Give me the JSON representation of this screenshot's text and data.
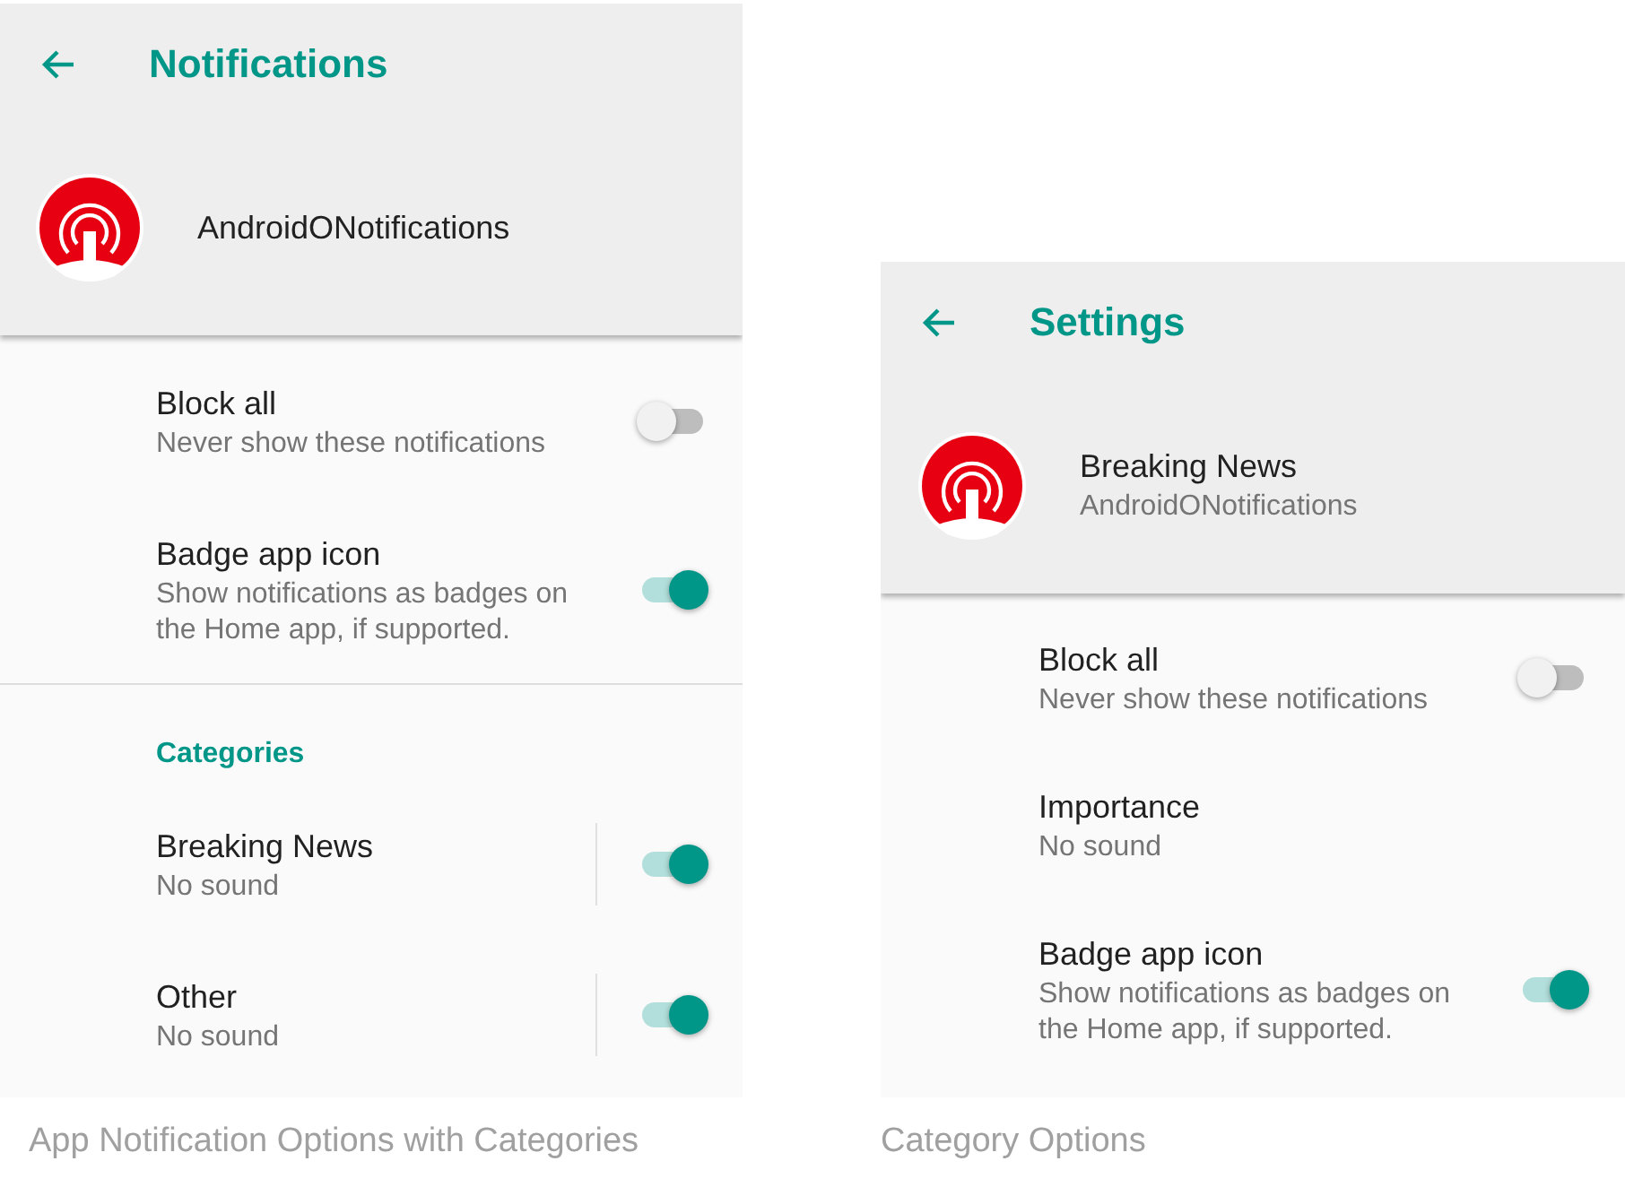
{
  "screens": [
    {
      "title": "Notifications",
      "app": {
        "name": "AndroidONotifications"
      },
      "caption": "App Notification Options with Categories",
      "items": [
        {
          "kind": "toggle",
          "title": "Block all",
          "summary": "Never show these notifications",
          "on": false,
          "divided": false
        },
        {
          "kind": "toggle",
          "title": "Badge app icon",
          "summary": "Show notifications as badges on the Home app, if supported.",
          "on": true,
          "divided": false
        },
        {
          "kind": "divider"
        },
        {
          "kind": "header",
          "title": "Categories"
        },
        {
          "kind": "toggle",
          "title": "Breaking News",
          "summary": "No sound",
          "on": true,
          "divided": true
        },
        {
          "kind": "toggle",
          "title": "Other",
          "summary": "No sound",
          "on": true,
          "divided": true
        }
      ]
    },
    {
      "title": "Settings",
      "app": {
        "name": "Breaking News",
        "subtitle": "AndroidONotifications"
      },
      "caption": "Category Options",
      "items": [
        {
          "kind": "toggle",
          "title": "Block all",
          "summary": "Never show these notifications",
          "on": false,
          "divided": false
        },
        {
          "kind": "text",
          "title": "Importance",
          "summary": "No sound"
        },
        {
          "kind": "toggle",
          "title": "Badge app icon",
          "summary": "Show notifications as badges on the Home app, if supported.",
          "on": true,
          "divided": false
        }
      ]
    }
  ]
}
